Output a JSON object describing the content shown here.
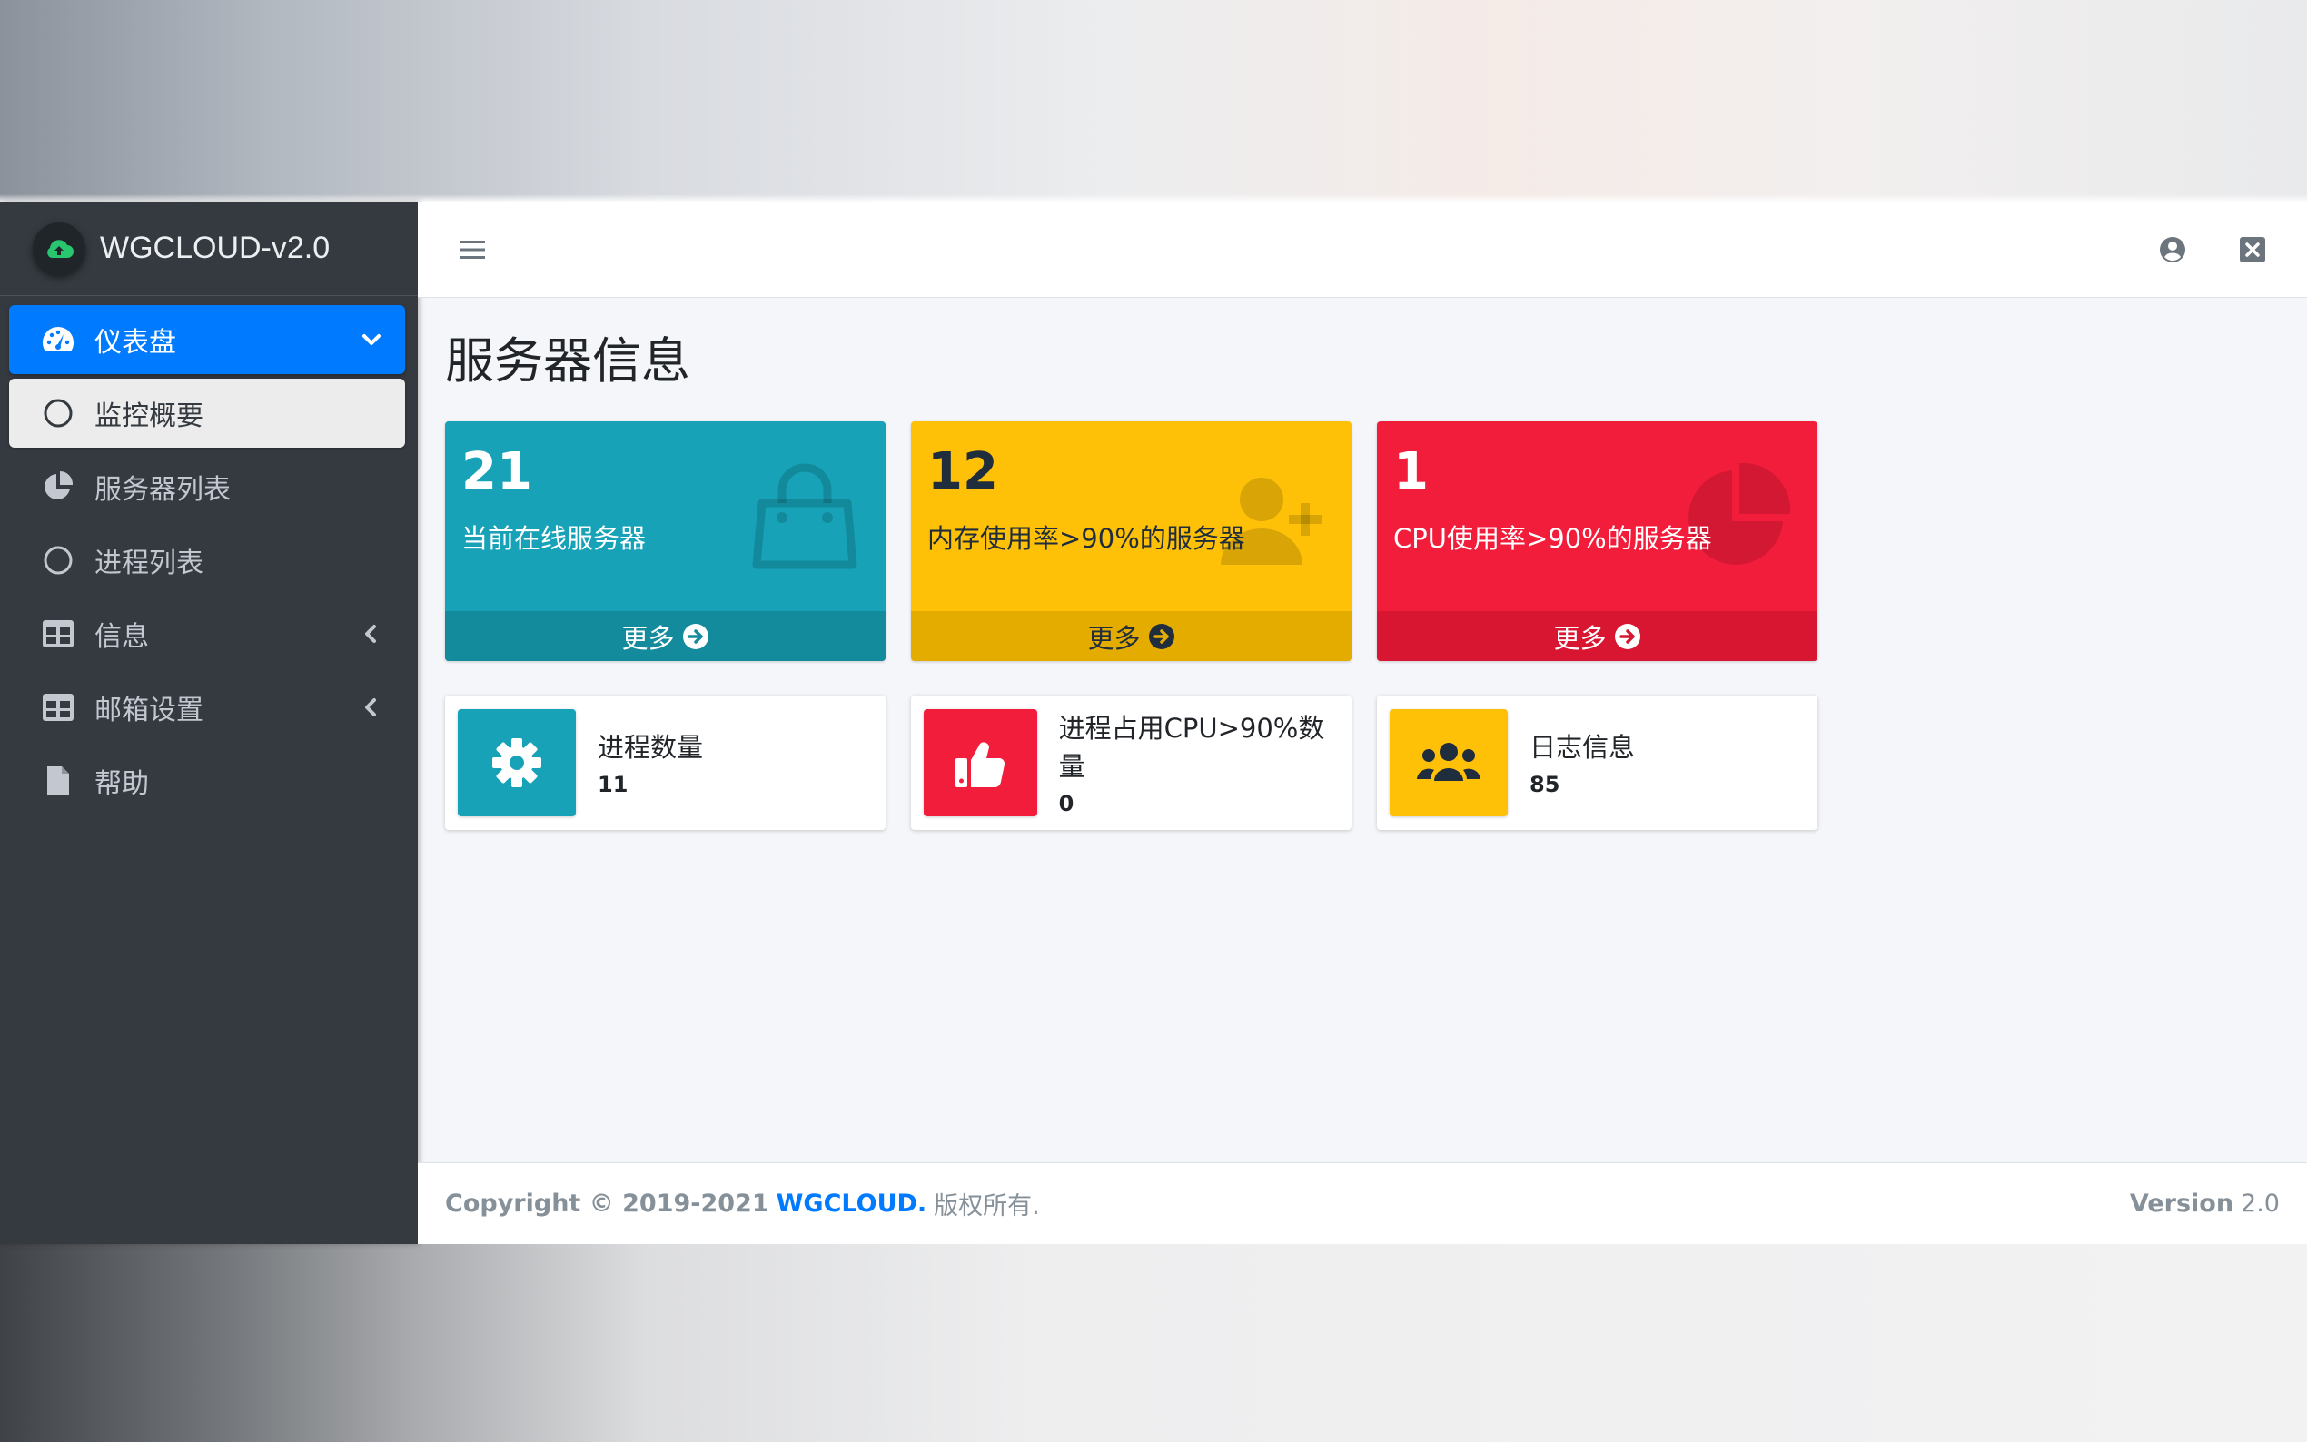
{
  "app": {
    "brand": "WGCLOUD-v2.0"
  },
  "sidebar": {
    "items": [
      {
        "label": "仪表盘",
        "icon": "tachometer-icon",
        "state": "active",
        "arrow": "chevron-down"
      },
      {
        "label": "监控概要",
        "icon": "circle-icon",
        "state": "sub-active"
      },
      {
        "label": "服务器列表",
        "icon": "pie-chart-icon"
      },
      {
        "label": "进程列表",
        "icon": "circle-icon"
      },
      {
        "label": "信息",
        "icon": "table-icon",
        "arrow": "chevron-left"
      },
      {
        "label": "邮箱设置",
        "icon": "table-icon",
        "arrow": "chevron-left"
      },
      {
        "label": "帮助",
        "icon": "file-icon"
      }
    ]
  },
  "page": {
    "title": "服务器信息"
  },
  "small_boxes": [
    {
      "value": "21",
      "label": "当前在线服务器",
      "more": "更多",
      "color": "#17a2b8",
      "icon": "shopping-bag-icon"
    },
    {
      "value": "12",
      "label": "内存使用率>90%的服务器",
      "more": "更多",
      "color": "#ffc107",
      "icon": "user-plus-icon"
    },
    {
      "value": "1",
      "label": "CPU使用率>90%的服务器",
      "more": "更多",
      "color": "#f21c3b",
      "icon": "pie-chart-icon"
    }
  ],
  "info_boxes": [
    {
      "label": "进程数量",
      "value": "11",
      "color": "#17a2b8",
      "icon": "gear-icon"
    },
    {
      "label": "进程占用CPU>90%数量",
      "value": "0",
      "color": "#f21c3b",
      "icon": "thumbs-up-icon"
    },
    {
      "label": "日志信息",
      "value": "85",
      "color": "#ffc107",
      "icon": "users-icon"
    }
  ],
  "footer": {
    "copyright": "Copyright © 2019-2021",
    "brand": "WGCLOUD.",
    "rights": "版权所有.",
    "version_label": "Version",
    "version": "2.0"
  }
}
